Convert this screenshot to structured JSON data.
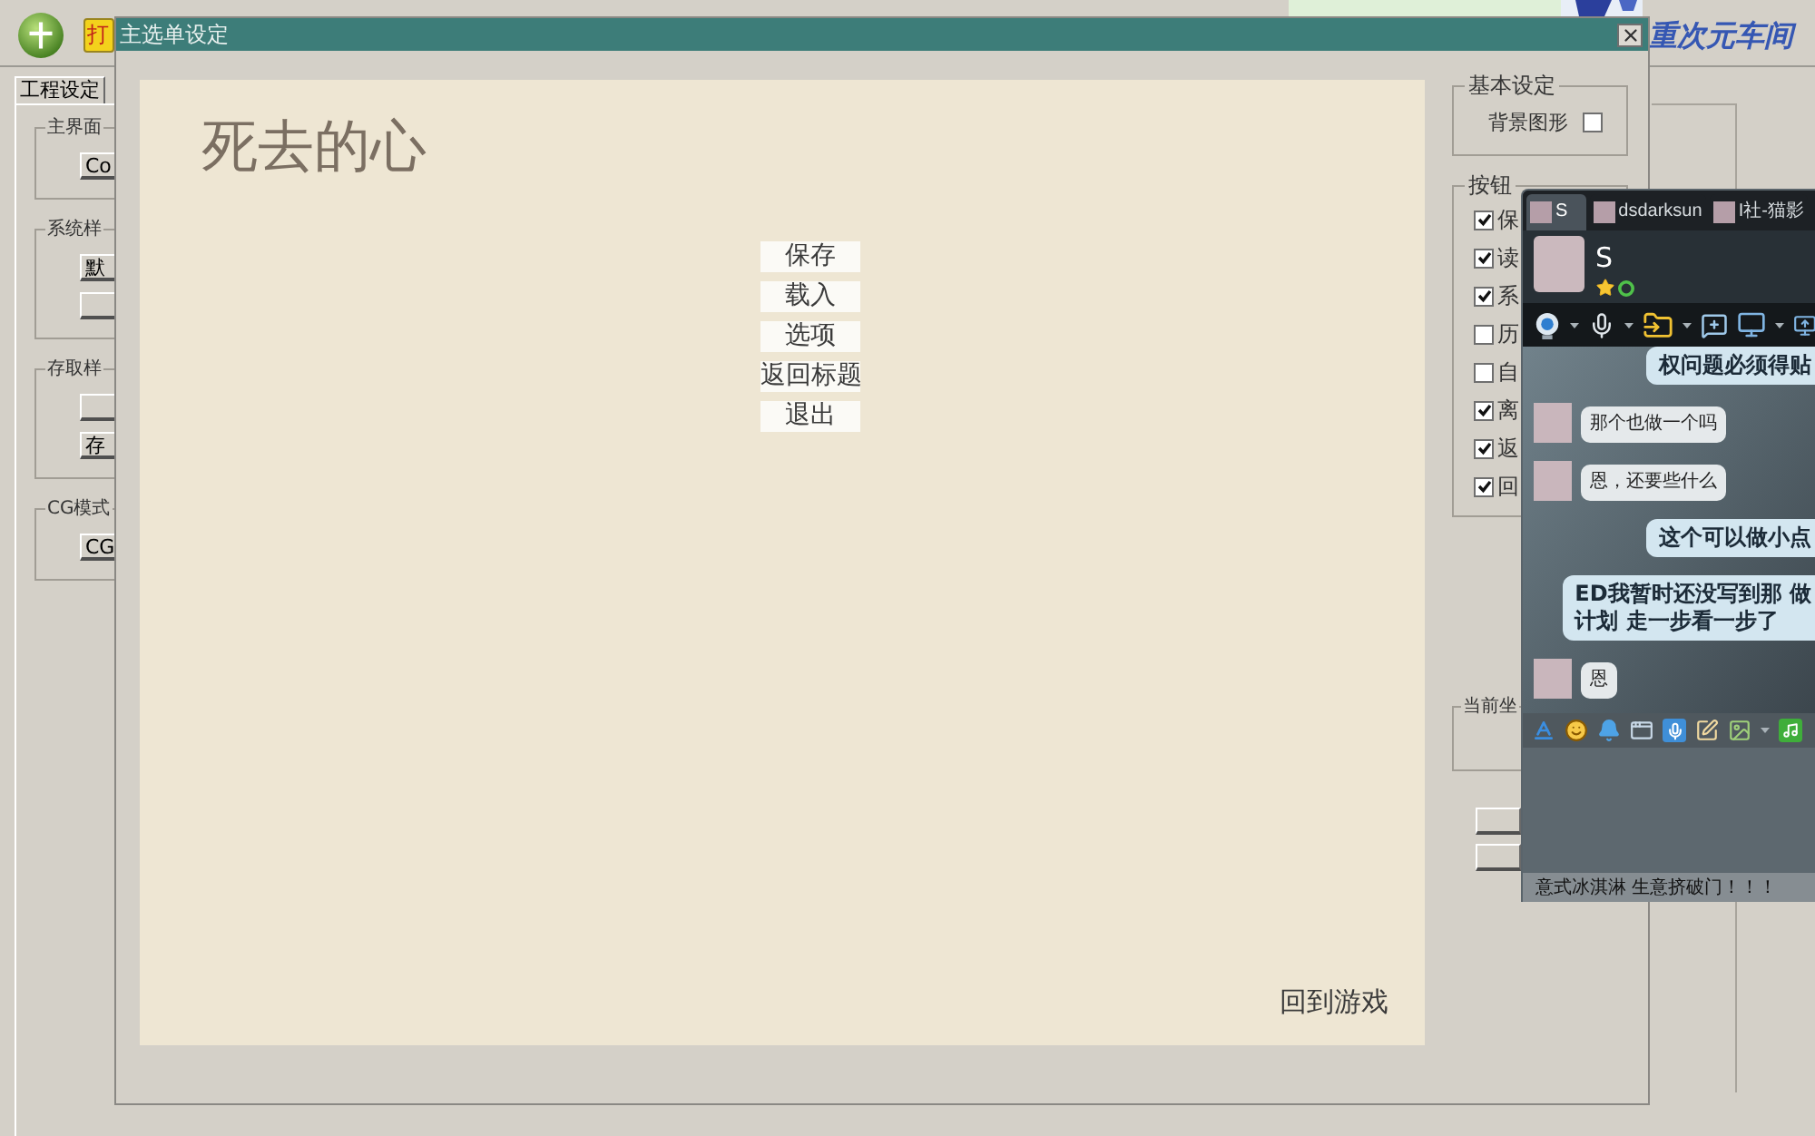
{
  "app": {
    "toolbar_button": "打",
    "logo": "重次元车间"
  },
  "project_panel": {
    "tabs": [
      {
        "label": "工程设定",
        "selected": true
      }
    ],
    "groups": [
      {
        "title": "主界面",
        "buttons": [
          {
            "kind": "labeled",
            "label": "Co"
          }
        ]
      },
      {
        "title": "系统样",
        "buttons": [
          {
            "kind": "labeled",
            "label": "默"
          },
          {
            "kind": "blank"
          }
        ]
      },
      {
        "title": "存取样",
        "buttons": [
          {
            "kind": "blank"
          },
          {
            "kind": "labeled",
            "label": "存"
          }
        ]
      },
      {
        "title": "CG模式",
        "buttons": [
          {
            "kind": "labeled",
            "label": "CG"
          }
        ]
      }
    ]
  },
  "dialog": {
    "title": "主选单设定",
    "preview": {
      "game_title": "死去的心",
      "menu_items": [
        "保存",
        "载入",
        "选项",
        "返回标题",
        "退出"
      ],
      "return_label": "回到游戏"
    },
    "basic_settings": {
      "title": "基本设定",
      "options": [
        {
          "label": "背景图形",
          "checked": false
        }
      ]
    },
    "button_settings": {
      "title": "按钮",
      "options": [
        {
          "label": "保",
          "checked": true
        },
        {
          "label": "读",
          "checked": true
        },
        {
          "label": "系",
          "checked": true
        },
        {
          "label": "历",
          "checked": false
        },
        {
          "label": "自",
          "checked": false
        },
        {
          "label": "离",
          "checked": true
        },
        {
          "label": "返",
          "checked": true
        },
        {
          "label": "回",
          "checked": true
        }
      ]
    },
    "position_settings": {
      "title": "当前坐"
    },
    "side_buttons": [
      {
        "kind": "blank"
      },
      {
        "kind": "blank"
      }
    ]
  },
  "chat": {
    "tabs": [
      {
        "label": "S",
        "selected": true
      },
      {
        "label": "dsdarksun",
        "selected": false
      },
      {
        "label": "I社-猫影",
        "selected": false
      }
    ],
    "contact": {
      "name": "S"
    },
    "messages": [
      {
        "kind": "sent",
        "lines": [
          "权问题必须得贴"
        ]
      },
      {
        "kind": "received",
        "lines": [
          "那个也做一个吗"
        ]
      },
      {
        "kind": "received",
        "lines": [
          "恩，还要些什么"
        ]
      },
      {
        "kind": "sent",
        "lines": [
          "这个可以做小点"
        ]
      },
      {
        "kind": "sent",
        "lines": [
          "ED我暂时还没写到那 做",
          "计划 走一步看一步了"
        ]
      },
      {
        "kind": "received",
        "lines": [
          "恩"
        ]
      }
    ],
    "status_text": "意式冰淇淋 生意挤破门！！！"
  }
}
